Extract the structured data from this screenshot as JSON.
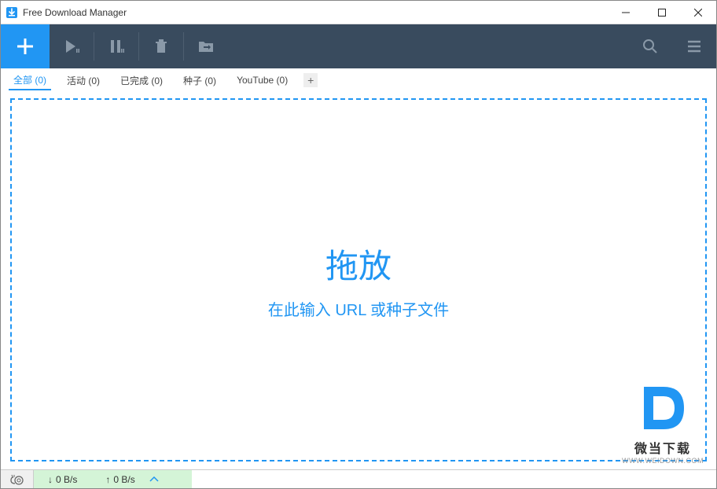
{
  "titlebar": {
    "title": "Free Download Manager"
  },
  "tabs": {
    "all": "全部 (0)",
    "active": "活动 (0)",
    "completed": "已完成 (0)",
    "torrents": "种子 (0)",
    "youtube": "YouTube (0)"
  },
  "drop": {
    "title": "拖放",
    "sub": "在此输入 URL 或种子文件"
  },
  "status": {
    "down": "0 B/s",
    "up": "0 B/s"
  },
  "watermark": {
    "text": "微当下载",
    "url": "WWW.WEIDOWN.COM"
  }
}
